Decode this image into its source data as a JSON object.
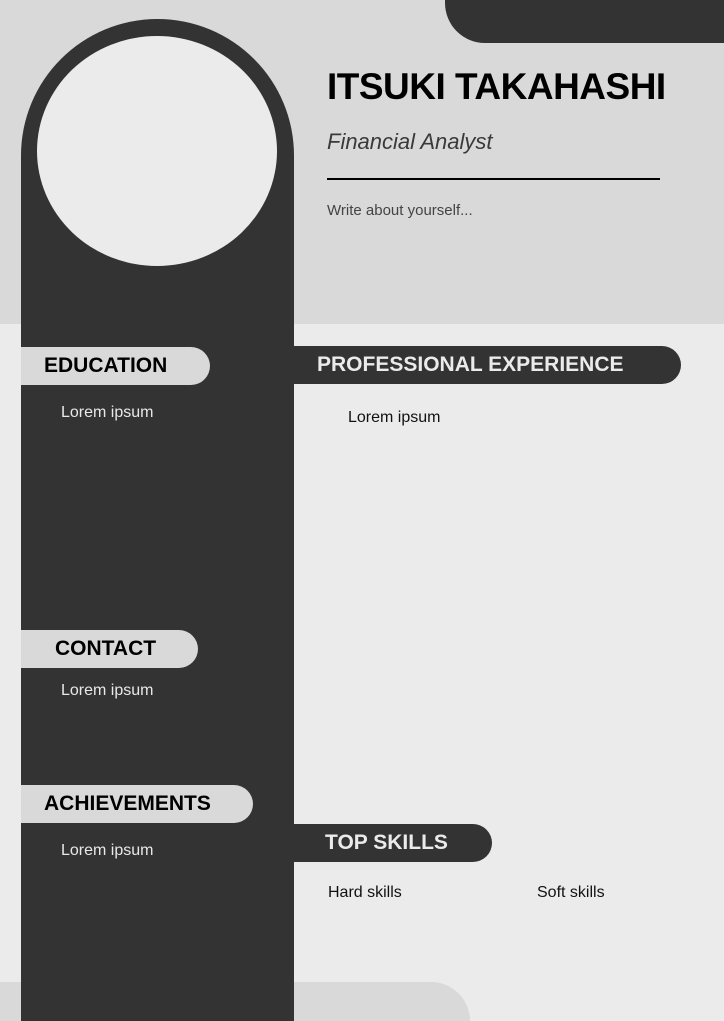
{
  "header": {
    "name": "ITSUKI TAKAHASHI",
    "job_title": "Financial Analyst",
    "about": "Write about yourself..."
  },
  "sidebar": {
    "education": {
      "heading": "EDUCATION",
      "body": "Lorem ipsum"
    },
    "contact": {
      "heading": "CONTACT",
      "body": "Lorem ipsum"
    },
    "achievements": {
      "heading": "ACHIEVEMENTS",
      "body": "Lorem ipsum"
    }
  },
  "main": {
    "experience": {
      "heading": "PROFESSIONAL  EXPERIENCE",
      "body": "Lorem ipsum"
    },
    "skills": {
      "heading": "TOP SKILLS",
      "hard_label": "Hard skills",
      "soft_label": "Soft skills"
    }
  },
  "colors": {
    "dark": "#333333",
    "light_band": "#d9d9d9",
    "page_background": "#ebebeb"
  }
}
